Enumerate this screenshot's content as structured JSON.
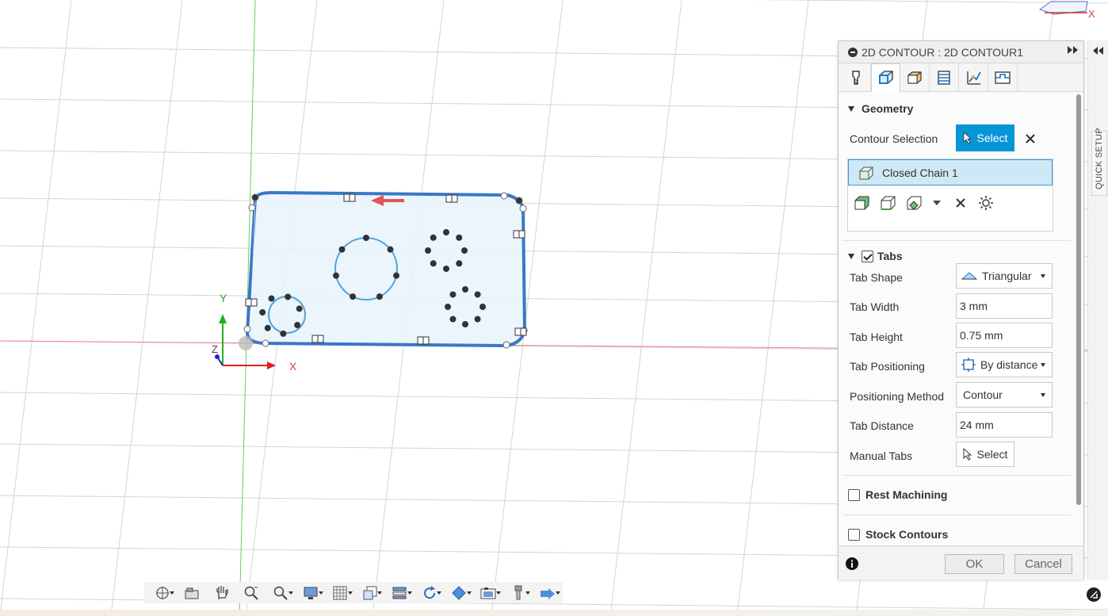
{
  "viewport": {
    "axis_x_label": "X",
    "axis_y_label": "Y",
    "axis_z_label": "Z",
    "viewcube_label": "X"
  },
  "dialog": {
    "title": "2D CONTOUR : 2D CONTOUR1",
    "tabs": [
      {
        "icon": "tool-icon",
        "active": false
      },
      {
        "icon": "geometry-icon",
        "active": true
      },
      {
        "icon": "heights-icon",
        "active": false
      },
      {
        "icon": "passes-icon",
        "active": false
      },
      {
        "icon": "linking-icon",
        "active": false
      },
      {
        "icon": "tabs-icon",
        "active": false
      }
    ],
    "geometry": {
      "heading": "Geometry",
      "contour_selection_label": "Contour Selection",
      "select_button": "Select",
      "chain_item": "Closed Chain 1"
    },
    "tabs_section": {
      "heading": "Tabs",
      "checked": true,
      "tab_shape_label": "Tab Shape",
      "tab_shape_value": "Triangular",
      "tab_width_label": "Tab Width",
      "tab_width_value": "3 mm",
      "tab_height_label": "Tab Height",
      "tab_height_value": "0.75 mm",
      "tab_positioning_label": "Tab Positioning",
      "tab_positioning_value": "By distance",
      "positioning_method_label": "Positioning Method",
      "positioning_method_value": "Contour",
      "tab_distance_label": "Tab Distance",
      "tab_distance_value": "24 mm",
      "manual_tabs_label": "Manual Tabs",
      "manual_tabs_button": "Select"
    },
    "rest_machining": {
      "label": "Rest Machining",
      "checked": false
    },
    "stock_contours": {
      "label": "Stock Contours",
      "checked": false
    },
    "ok_button": "OK",
    "cancel_button": "Cancel"
  },
  "side_panel": {
    "quick_setup": "QUICK SETUP"
  },
  "colors": {
    "accent": "#0696d7",
    "chain_highlight": "#cfe8f6",
    "contour_blue": "#3a7bd5",
    "axis_red": "#e04040",
    "axis_green": "#20b020"
  },
  "toolbar": {
    "tools": [
      "orbit-icon",
      "home-view-icon",
      "pan-icon",
      "zoom-icon",
      "zoom-window-icon",
      "display-settings-icon",
      "grid-icon",
      "viewports-icon",
      "section-icon",
      "rotate-icon",
      "visual-style-icon",
      "capture-icon",
      "tool-library-icon",
      "simulate-icon"
    ]
  }
}
